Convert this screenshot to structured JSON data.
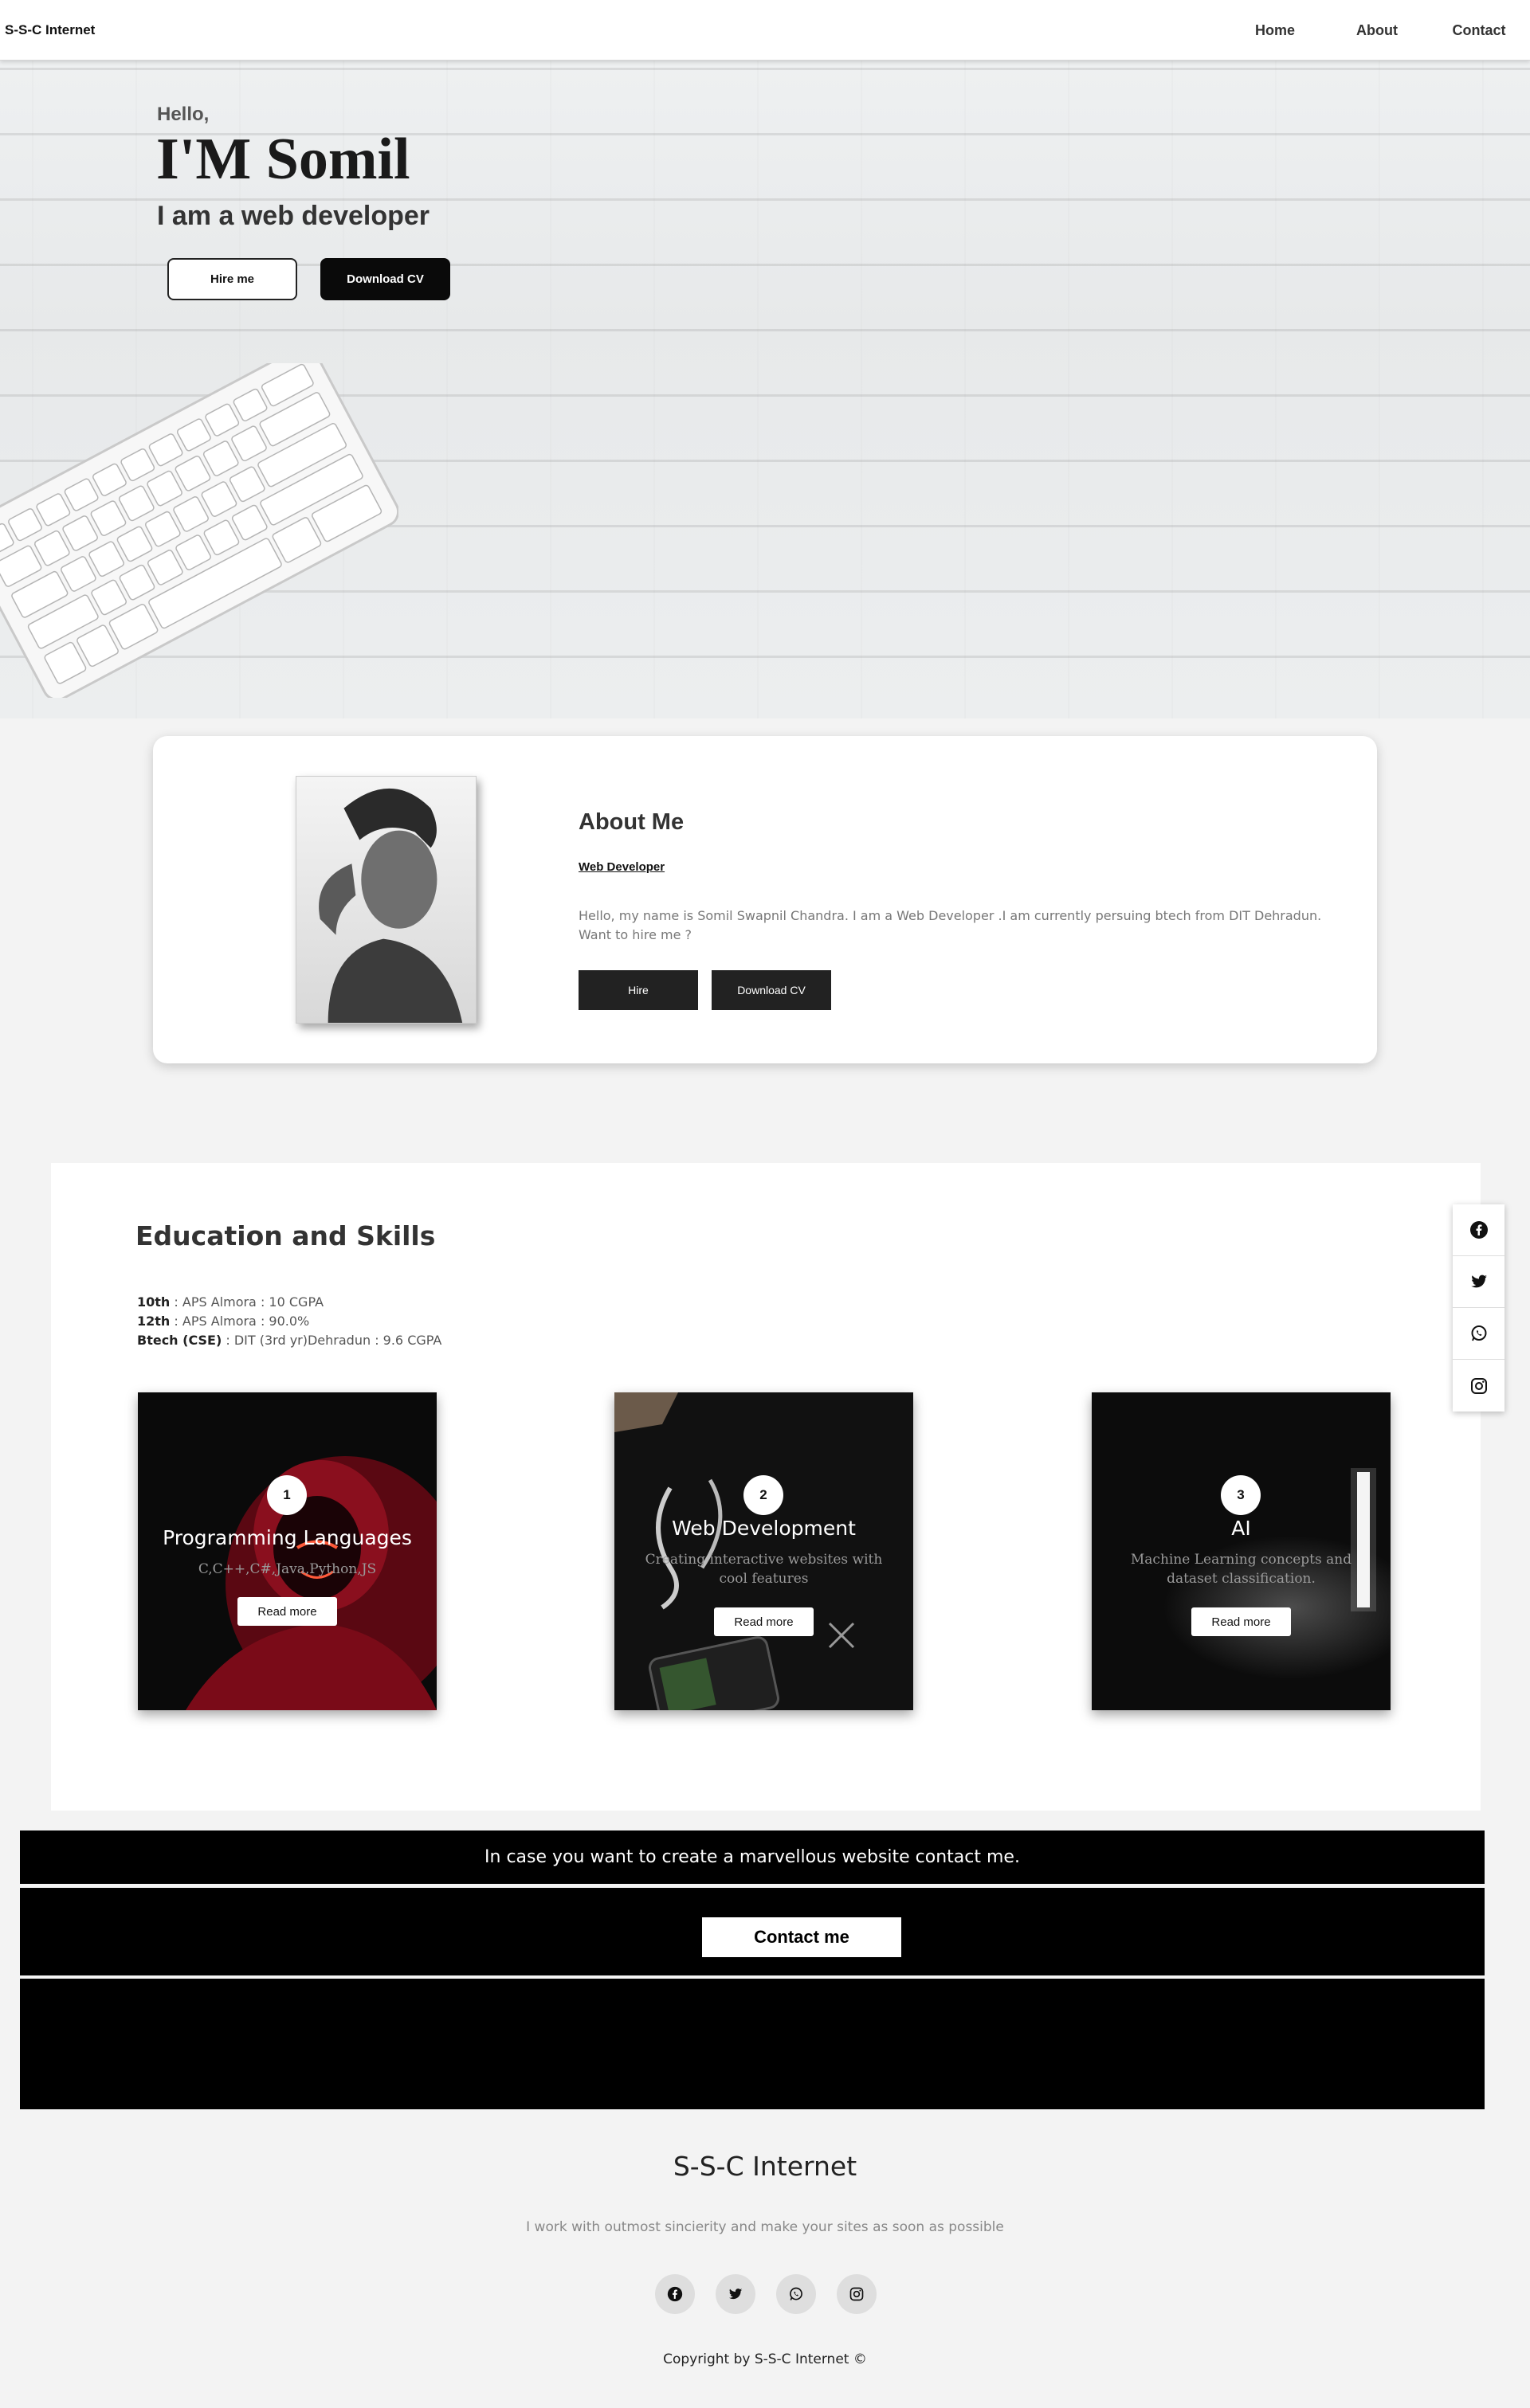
{
  "nav": {
    "brand": "S-S-C Internet",
    "items": [
      {
        "label": "Home"
      },
      {
        "label": "About"
      },
      {
        "label": "Contact"
      }
    ]
  },
  "hero": {
    "greeting": "Hello,",
    "name": "I'M Somil",
    "role": "I am a web developer",
    "hire_label": "Hire me",
    "cv_label": "Download CV"
  },
  "about": {
    "title": "About Me",
    "subtitle": "Web Developer",
    "text": "Hello, my name is Somil Swapnil Chandra. I am a Web Developer .I am currently persuing btech from DIT Dehradun. Want to hire me ?",
    "hire_label": "Hire",
    "cv_label": "Download CV"
  },
  "education": {
    "title": "Education and Skills",
    "lines": [
      {
        "level": "10th",
        "detail": " : APS Almora : 10 CGPA"
      },
      {
        "level": "12th",
        "detail": " : APS Almora : 90.0%"
      },
      {
        "level": "Btech (CSE)",
        "detail": " : DIT (3rd yr)Dehradun : 9.6 CGPA"
      }
    ],
    "cards": [
      {
        "num": "1",
        "title": "Programming Languages",
        "desc": "C,C++,C#,Java,Python,JS",
        "button": "Read more"
      },
      {
        "num": "2",
        "title": "Web Development",
        "desc": "Creating interactive websites with cool features",
        "button": "Read more"
      },
      {
        "num": "3",
        "title": "AI",
        "desc": "Machine Learning concepts and dataset classification.",
        "button": "Read more"
      }
    ]
  },
  "social_sidebar": [
    "facebook-icon",
    "twitter-icon",
    "whatsapp-icon",
    "instagram-icon"
  ],
  "contact": {
    "message": "In case you want to create a marvellous website contact me.",
    "button": "Contact me"
  },
  "footer": {
    "title": "S-S-C Internet",
    "subtitle": "I work with outmost sincierity and make your sites as soon as possible",
    "icons": [
      "facebook-icon",
      "twitter-icon",
      "whatsapp-icon",
      "instagram-icon"
    ],
    "copyright": "Copyright by S-S-C Internet ©"
  },
  "colors": {
    "page_bg": "#f3f3f3",
    "dark": "#0a0a0a",
    "button_dark": "#222222"
  }
}
